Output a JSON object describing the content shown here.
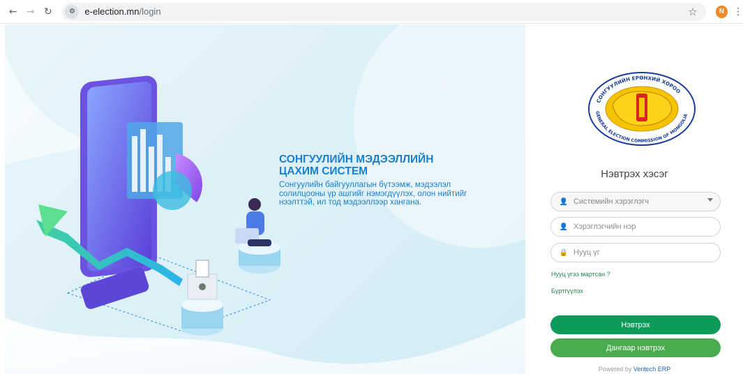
{
  "browser": {
    "url_host": "e-election.mn",
    "url_path": "/login",
    "profile_initial": "N",
    "icons": [
      "back-icon",
      "forward-icon",
      "reload-icon",
      "site-info-icon",
      "star-icon",
      "menu-icon"
    ]
  },
  "hero": {
    "title_line1": "СОНГУУЛИЙН МЭДЭЭЛЛИЙН",
    "title_line2": "ЦАХИМ СИСТЕМ",
    "desc_line1": "Сонгуулийн байгууллагын бүтээмж, мэдээлэл",
    "desc_line2": "солилцооны үр ашгийг нэмэгдүүлэх, олон нийтийг",
    "desc_line3": "нээлттэй, ил тод мэдээллээр хангана."
  },
  "emblem": {
    "top_text": "СОНГУУЛИЙН ЕРӨНХИЙ ХОРОО",
    "bottom_text": "GENERAL ELECTION COMMISSION OF MONGOLIA"
  },
  "login": {
    "heading": "Нэвтрэх хэсэг",
    "user_type_value": "Системийн хэрэглэгч",
    "username_placeholder": "Хэрэглэгчийн нэр",
    "password_placeholder": "Нууц үг",
    "forgot_link": "Нууц үгээ мартсан ?",
    "register_link": "Бүртгүүлэх",
    "login_button": "Нэвтрэх",
    "sign_login_button": "Дангаар нэвтрэх",
    "powered_prefix": "Powered by",
    "powered_brand": "Veritech ERP"
  },
  "colors": {
    "primary_green": "#0e9a58",
    "secondary_green": "#48ac4e",
    "hero_blue": "#1a7fd0",
    "link_green": "#1f8a4c"
  }
}
